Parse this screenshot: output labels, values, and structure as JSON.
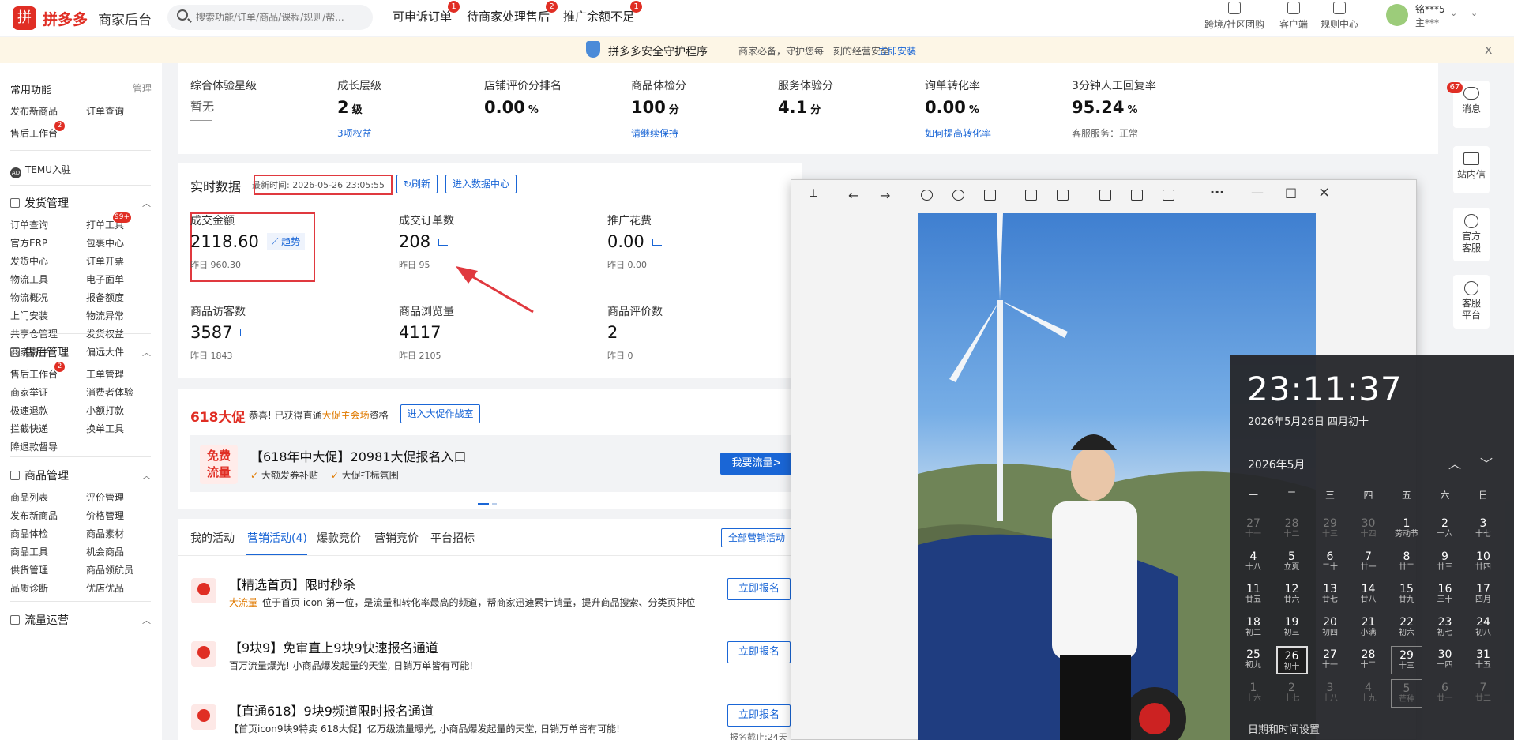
{
  "topbar": {
    "logo_glyph": "拼",
    "brand": "拼多多",
    "brand_sub": "商家后台",
    "search_placeholder": "搜索功能/订单/商品/课程/规则/帮...",
    "links": [
      {
        "label": "可申诉订单",
        "badge": "1"
      },
      {
        "label": "待商家处理售后",
        "badge": "2"
      },
      {
        "label": "推广余额不足",
        "badge": "1"
      }
    ],
    "tools": [
      {
        "label": "跨境/社区团购",
        "icon": "community-icon"
      },
      {
        "label": "客户端",
        "icon": "client-icon"
      },
      {
        "label": "规则中心",
        "icon": "rules-icon"
      }
    ],
    "user_name": "铭***5",
    "user_role": "主***"
  },
  "notice": {
    "title": "拼多多安全守护程序",
    "subtitle": "商家必备，守护您每一刻的经营安全",
    "link": "立即安装",
    "close": "x"
  },
  "sidebar": {
    "common_title": "常用功能",
    "manage": "管理",
    "common": [
      {
        "label": "发布新商品"
      },
      {
        "label": "订单查询"
      },
      {
        "label": "售后工作台",
        "badge": "2"
      }
    ],
    "temu": "TEMU入驻",
    "groups": [
      {
        "title": "发货管理",
        "items": [
          {
            "label": "订单查询"
          },
          {
            "label": "打单工具",
            "badge": "99+"
          },
          {
            "label": "官方ERP"
          },
          {
            "label": "包裹中心"
          },
          {
            "label": "发货中心"
          },
          {
            "label": "订单开票"
          },
          {
            "label": "物流工具"
          },
          {
            "label": "电子面单"
          },
          {
            "label": "物流概况"
          },
          {
            "label": "报备额度"
          },
          {
            "label": "上门安装"
          },
          {
            "label": "物流异常"
          },
          {
            "label": "共享仓管理"
          },
          {
            "label": "发货权益"
          },
          {
            "label": "商家寄件"
          },
          {
            "label": "偏远大件"
          }
        ]
      },
      {
        "title": "售后管理",
        "items": [
          {
            "label": "售后工作台",
            "badge": "2"
          },
          {
            "label": "工单管理"
          },
          {
            "label": "商家举证"
          },
          {
            "label": "消费者体验"
          },
          {
            "label": "极速退款"
          },
          {
            "label": "小额打款"
          },
          {
            "label": "拦截快递"
          },
          {
            "label": "换单工具"
          },
          {
            "label": "降退款督导"
          }
        ]
      },
      {
        "title": "商品管理",
        "items": [
          {
            "label": "商品列表"
          },
          {
            "label": "评价管理"
          },
          {
            "label": "发布新商品"
          },
          {
            "label": "价格管理"
          },
          {
            "label": "商品体检"
          },
          {
            "label": "商品素材"
          },
          {
            "label": "商品工具"
          },
          {
            "label": "机会商品"
          },
          {
            "label": "供货管理"
          },
          {
            "label": "商品领航员"
          },
          {
            "label": "品质诊断"
          },
          {
            "label": "优店优品"
          }
        ]
      },
      {
        "title": "流量运营",
        "items": []
      }
    ]
  },
  "overview": {
    "items": [
      {
        "label": "综合体验星级",
        "value": "暂无",
        "unit": "",
        "sub": ""
      },
      {
        "label": "成长层级",
        "value": "2",
        "unit": "级",
        "sub": "3项权益"
      },
      {
        "label": "店铺评价分排名",
        "value": "0.00",
        "unit": "%",
        "sub": ""
      },
      {
        "label": "商品体检分",
        "value": "100",
        "unit": "分",
        "sub": "请继续保持"
      },
      {
        "label": "服务体验分",
        "value": "4.1",
        "unit": "分",
        "sub": ""
      },
      {
        "label": "询单转化率",
        "value": "0.00",
        "unit": "%",
        "sub": "如何提高转化率"
      },
      {
        "label": "3分钟人工回复率",
        "value": "95.24",
        "unit": "%",
        "sub": "客服服务：正常"
      }
    ]
  },
  "realtime": {
    "title": "实时数据",
    "update_time": "最新时间: 2026-05-26 23:05:55",
    "refresh": "刷新",
    "data_center": "进入数据中心",
    "trend": "趋势",
    "metrics": [
      {
        "label": "成交金额",
        "value": "2118.60",
        "yesterday": "昨日 960.30"
      },
      {
        "label": "成交订单数",
        "value": "208",
        "yesterday": "昨日 95"
      },
      {
        "label": "推广花费",
        "value": "0.00",
        "yesterday": "昨日 0.00"
      },
      {
        "label": "商品访客数",
        "value": "3587",
        "yesterday": "昨日 1843"
      },
      {
        "label": "商品浏览量",
        "value": "4117",
        "yesterday": "昨日 2105"
      },
      {
        "label": "商品评价数",
        "value": "2",
        "yesterday": "昨日 0"
      }
    ]
  },
  "promo": {
    "tag": "618大促",
    "congrats_pre": "恭喜! 已获得直通",
    "congrats_hl": "大促主会场",
    "congrats_post": "资格",
    "war_room": "进入大促作战室",
    "badge_line1": "免费",
    "badge_line2": "流量",
    "banner_title": "【618年中大促】20981大促报名入口",
    "check1": "大额发券补贴",
    "check2": "大促打标氛围",
    "cta": "我要流量>"
  },
  "activities": {
    "tabs": [
      "我的活动",
      "营销活动(4)",
      "爆款竞价",
      "营销竞价",
      "平台招标"
    ],
    "all": "全部营销活动",
    "items": [
      {
        "title": "【精选首页】限时秒杀",
        "desc_hl": "大流量",
        "desc": "位于首页 icon 第一位，是流量和转化率最高的频道，帮商家迅速累计销量，提升商品搜索、分类页排位",
        "btn": "立即报名",
        "note": ""
      },
      {
        "title": "【9块9】免审直上9块9快速报名通道",
        "desc_hl": "",
        "desc": "百万流量爆光! 小商品爆发起量的天堂, 日销万单皆有可能!",
        "btn": "立即报名",
        "note": ""
      },
      {
        "title": "【直通618】9块9频道限时报名通道",
        "desc_hl": "",
        "desc": "【首页icon9块9特卖 618大促】亿万级流量曝光, 小商品爆发起量的天堂, 日销万单皆有可能!",
        "btn": "立即报名",
        "note": "报名截止:24天"
      }
    ]
  },
  "rail": {
    "message_badge": "67",
    "items": [
      "消息",
      "站内信",
      "官方客服",
      "客服平台"
    ]
  },
  "viewer": {
    "more": "···",
    "min": "—",
    "max": "□",
    "close": "×"
  },
  "calendar": {
    "time": "23:11:37",
    "date_line": "2026年5月26日 四月初十",
    "month": "2026年5月",
    "settings": "日期和时间设置",
    "weekdays": [
      "一",
      "二",
      "三",
      "四",
      "五",
      "六",
      "日"
    ],
    "days": [
      [
        "27",
        "十一",
        1
      ],
      [
        "28",
        "十二",
        1
      ],
      [
        "29",
        "十三",
        1
      ],
      [
        "30",
        "十四",
        1
      ],
      [
        "1",
        "劳动节",
        0
      ],
      [
        "2",
        "十六",
        0
      ],
      [
        "3",
        "十七",
        0
      ],
      [
        "4",
        "十八",
        0
      ],
      [
        "5",
        "立夏",
        0
      ],
      [
        "6",
        "二十",
        0
      ],
      [
        "7",
        "廿一",
        0
      ],
      [
        "8",
        "廿二",
        0
      ],
      [
        "9",
        "廿三",
        0
      ],
      [
        "10",
        "廿四",
        0
      ],
      [
        "11",
        "廿五",
        0
      ],
      [
        "12",
        "廿六",
        0
      ],
      [
        "13",
        "廿七",
        0
      ],
      [
        "14",
        "廿八",
        0
      ],
      [
        "15",
        "廿九",
        0
      ],
      [
        "16",
        "三十",
        0
      ],
      [
        "17",
        "四月",
        0
      ],
      [
        "18",
        "初二",
        0
      ],
      [
        "19",
        "初三",
        0
      ],
      [
        "20",
        "初四",
        0
      ],
      [
        "21",
        "小满",
        0
      ],
      [
        "22",
        "初六",
        0
      ],
      [
        "23",
        "初七",
        0
      ],
      [
        "24",
        "初八",
        0
      ],
      [
        "25",
        "初九",
        0
      ],
      [
        "26",
        "初十",
        0
      ],
      [
        "27",
        "十一",
        0
      ],
      [
        "28",
        "十二",
        0
      ],
      [
        "29",
        "十三",
        0
      ],
      [
        "30",
        "十四",
        0
      ],
      [
        "31",
        "十五",
        0
      ],
      [
        "1",
        "十六",
        1
      ],
      [
        "2",
        "十七",
        1
      ],
      [
        "3",
        "十八",
        1
      ],
      [
        "4",
        "十九",
        1
      ],
      [
        "5",
        "芒种",
        1
      ],
      [
        "6",
        "廿一",
        1
      ],
      [
        "7",
        "廿二",
        1
      ]
    ]
  },
  "colors": {
    "brand": "#e02e24",
    "link": "#1a66d6",
    "annotation": "#e0393f"
  }
}
